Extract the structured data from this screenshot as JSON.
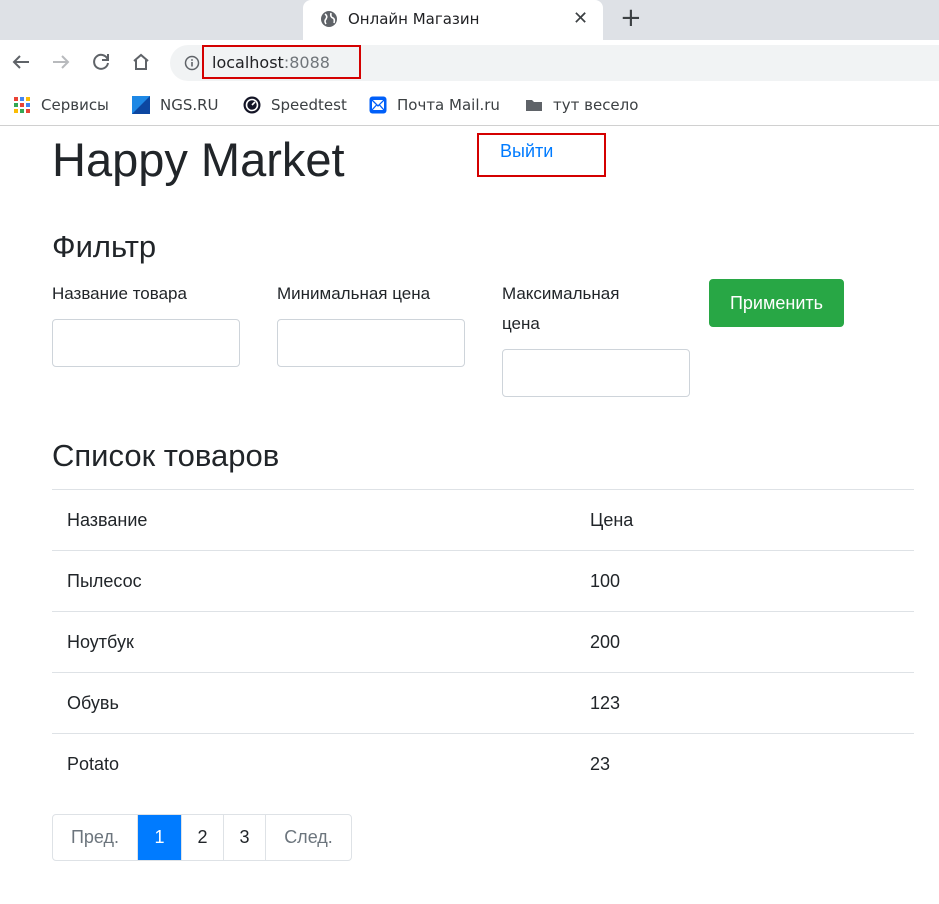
{
  "browser": {
    "tab_title": "Онлайн Магазин",
    "url_host": "localhost",
    "url_port": ":8088",
    "bookmarks": [
      {
        "label": "Сервисы",
        "icon": "apps-grid-icon"
      },
      {
        "label": "NGS.RU",
        "icon": "ngs-logo-icon"
      },
      {
        "label": "Speedtest",
        "icon": "speedtest-icon"
      },
      {
        "label": "Почта Mail.ru",
        "icon": "mail-icon"
      },
      {
        "label": "тут весело",
        "icon": "folder-icon"
      }
    ]
  },
  "header": {
    "title": "Happy Market",
    "logout_label": "Выйти"
  },
  "filter": {
    "title": "Фильтр",
    "name_label": "Название товара",
    "min_label": "Минимальная цена",
    "max_label_line1": "Максимальная",
    "max_label_line2": "цена",
    "name_value": "",
    "min_value": "",
    "max_value": "",
    "apply_label": "Применить"
  },
  "products": {
    "title": "Список товаров",
    "columns": [
      "Название",
      "Цена"
    ],
    "rows": [
      [
        "Пылесос",
        "100"
      ],
      [
        "Ноутбук",
        "200"
      ],
      [
        "Обувь",
        "123"
      ],
      [
        "Potato",
        "23"
      ]
    ]
  },
  "pagination": {
    "prev_label": "Пред.",
    "pages": [
      "1",
      "2",
      "3"
    ],
    "active_page": "1",
    "next_label": "След."
  },
  "colors": {
    "link": "#007bff",
    "apply_button": "#28a745",
    "active_page": "#007bff",
    "highlight_box": "#d40000"
  }
}
